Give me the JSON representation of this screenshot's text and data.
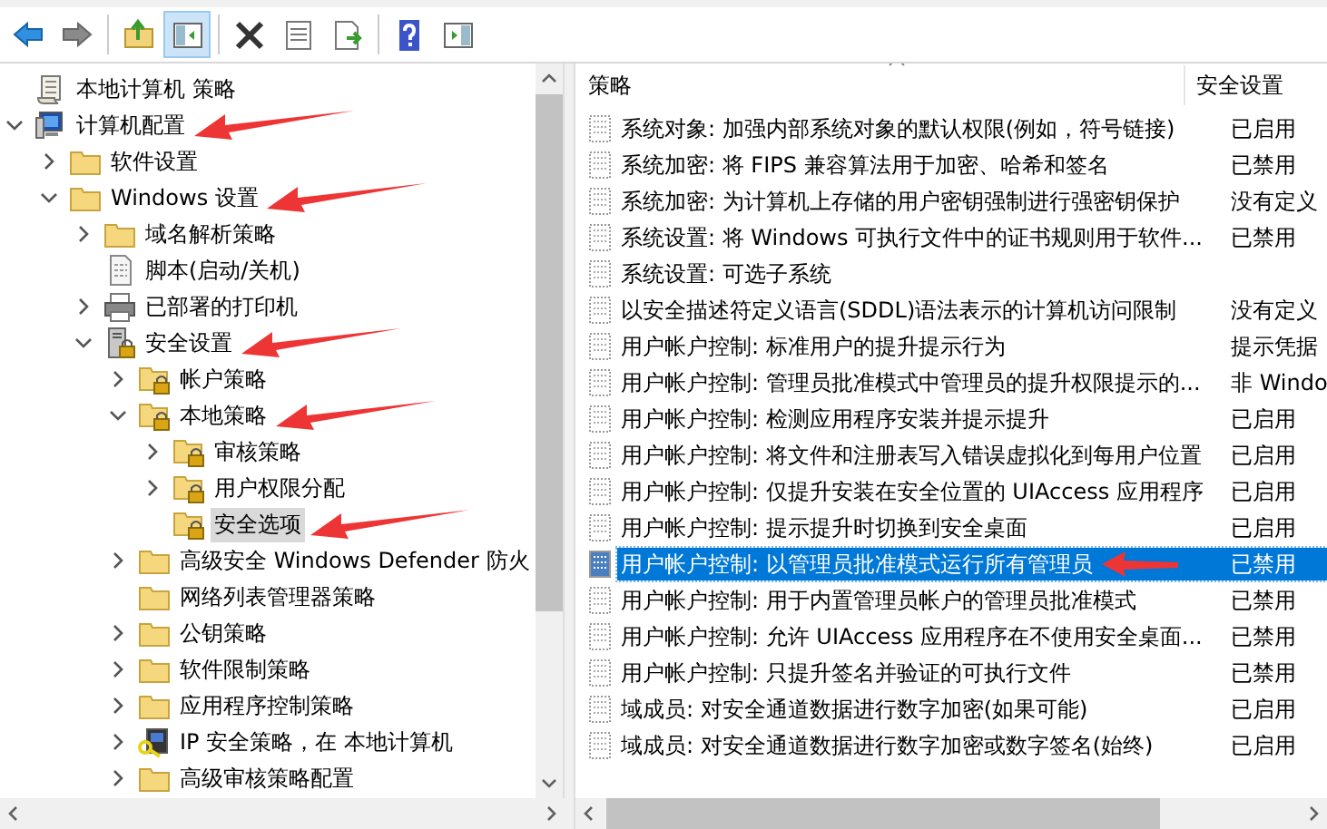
{
  "toolbar": {
    "buttons": [
      {
        "kind": "back",
        "pressed": false
      },
      {
        "kind": "forward",
        "pressed": false
      },
      {
        "kind": "up",
        "pressed": false
      },
      {
        "kind": "tree",
        "pressed": true
      },
      {
        "kind": "delete",
        "pressed": false
      },
      {
        "kind": "properties",
        "pressed": false
      },
      {
        "kind": "export",
        "pressed": false
      },
      {
        "kind": "help",
        "pressed": false
      },
      {
        "kind": "pane",
        "pressed": false
      }
    ]
  },
  "tree": {
    "items": [
      {
        "label": "本地计算机 策略",
        "kind": "policy-root",
        "selected": false,
        "arrow": false,
        "children": [
          {
            "label": "计算机配置",
            "kind": "computer",
            "expanded": true,
            "selected": false,
            "arrow": true,
            "children": [
              {
                "label": "软件设置",
                "kind": "folder",
                "expanded": false,
                "selected": false,
                "arrow": false
              },
              {
                "label": "Windows 设置",
                "kind": "folder",
                "expanded": true,
                "selected": false,
                "arrow": true,
                "children": [
                  {
                    "label": "域名解析策略",
                    "kind": "folder",
                    "expanded": false,
                    "selected": false,
                    "arrow": false
                  },
                  {
                    "label": "脚本(启动/关机)",
                    "kind": "script",
                    "selected": false,
                    "arrow": false
                  },
                  {
                    "label": "已部署的打印机",
                    "kind": "printer",
                    "expanded": false,
                    "selected": false,
                    "arrow": false
                  },
                  {
                    "label": "安全设置",
                    "kind": "security",
                    "expanded": true,
                    "selected": false,
                    "arrow": true,
                    "children": [
                      {
                        "label": "帐户策略",
                        "kind": "locked-folder",
                        "expanded": false,
                        "selected": false,
                        "arrow": false
                      },
                      {
                        "label": "本地策略",
                        "kind": "locked-folder",
                        "expanded": true,
                        "selected": false,
                        "arrow": true,
                        "children": [
                          {
                            "label": "审核策略",
                            "kind": "locked-folder",
                            "expanded": false,
                            "selected": false,
                            "arrow": false
                          },
                          {
                            "label": "用户权限分配",
                            "kind": "locked-folder",
                            "expanded": false,
                            "selected": false,
                            "arrow": false
                          },
                          {
                            "label": "安全选项",
                            "kind": "locked-folder",
                            "selected": true,
                            "arrow": true
                          }
                        ]
                      },
                      {
                        "label": "高级安全 Windows Defender 防火",
                        "kind": "folder",
                        "expanded": false,
                        "selected": false,
                        "arrow": false
                      },
                      {
                        "label": "网络列表管理器策略",
                        "kind": "folder",
                        "selected": false,
                        "arrow": false
                      },
                      {
                        "label": "公钥策略",
                        "kind": "folder",
                        "expanded": false,
                        "selected": false,
                        "arrow": false
                      },
                      {
                        "label": "软件限制策略",
                        "kind": "folder",
                        "expanded": false,
                        "selected": false,
                        "arrow": false
                      },
                      {
                        "label": "应用程序控制策略",
                        "kind": "folder",
                        "expanded": false,
                        "selected": false,
                        "arrow": false
                      },
                      {
                        "label": "IP 安全策略，在 本地计算机",
                        "kind": "ip",
                        "expanded": false,
                        "selected": false,
                        "arrow": false
                      },
                      {
                        "label": "高级审核策略配置",
                        "kind": "folder",
                        "expanded": false,
                        "selected": false,
                        "arrow": false
                      }
                    ]
                  }
                ]
              }
            ]
          }
        ]
      }
    ]
  },
  "list": {
    "columns": [
      "策略",
      "安全设置"
    ],
    "rows": [
      {
        "policy": "系统对象: 加强内部系统对象的默认权限(例如，符号链接)",
        "setting": "已启用",
        "selected": false,
        "arrow": false
      },
      {
        "policy": "系统加密: 将 FIPS 兼容算法用于加密、哈希和签名",
        "setting": "已禁用",
        "selected": false,
        "arrow": false
      },
      {
        "policy": "系统加密: 为计算机上存储的用户密钥强制进行强密钥保护",
        "setting": "没有定义",
        "selected": false,
        "arrow": false
      },
      {
        "policy": "系统设置: 将 Windows 可执行文件中的证书规则用于软件...",
        "setting": "已禁用",
        "selected": false,
        "arrow": false
      },
      {
        "policy": "系统设置: 可选子系统",
        "selected": false,
        "arrow": false
      },
      {
        "policy": "以安全描述符定义语言(SDDL)语法表示的计算机访问限制",
        "setting": "没有定义",
        "selected": false,
        "arrow": false
      },
      {
        "policy": "用户帐户控制: 标准用户的提升提示行为",
        "setting": "提示凭据",
        "selected": false,
        "arrow": false
      },
      {
        "policy": "用户帐户控制: 管理员批准模式中管理员的提升权限提示的...",
        "setting": "非 Windo",
        "selected": false,
        "arrow": false
      },
      {
        "policy": "用户帐户控制: 检测应用程序安装并提示提升",
        "setting": "已启用",
        "selected": false,
        "arrow": false
      },
      {
        "policy": "用户帐户控制: 将文件和注册表写入错误虚拟化到每用户位置",
        "setting": "已启用",
        "selected": false,
        "arrow": false
      },
      {
        "policy": "用户帐户控制: 仅提升安装在安全位置的 UIAccess 应用程序",
        "setting": "已启用",
        "selected": false,
        "arrow": false
      },
      {
        "policy": "用户帐户控制: 提示提升时切换到安全桌面",
        "setting": "已启用",
        "selected": false,
        "arrow": false
      },
      {
        "policy": "用户帐户控制: 以管理员批准模式运行所有管理员",
        "setting": "已禁用",
        "selected": true,
        "arrow": true
      },
      {
        "policy": "用户帐户控制: 用于内置管理员帐户的管理员批准模式",
        "setting": "已禁用",
        "selected": false,
        "arrow": false
      },
      {
        "policy": "用户帐户控制: 允许 UIAccess 应用程序在不使用安全桌面...",
        "setting": "已禁用",
        "selected": false,
        "arrow": false
      },
      {
        "policy": "用户帐户控制: 只提升签名并验证的可执行文件",
        "setting": "已禁用",
        "selected": false,
        "arrow": false
      },
      {
        "policy": "域成员: 对安全通道数据进行数字加密(如果可能)",
        "setting": "已启用",
        "selected": false,
        "arrow": false
      },
      {
        "policy": "域成员: 对安全通道数据进行数字加密或数字签名(始终)",
        "setting": "已启用",
        "selected": false,
        "arrow": false
      }
    ]
  }
}
